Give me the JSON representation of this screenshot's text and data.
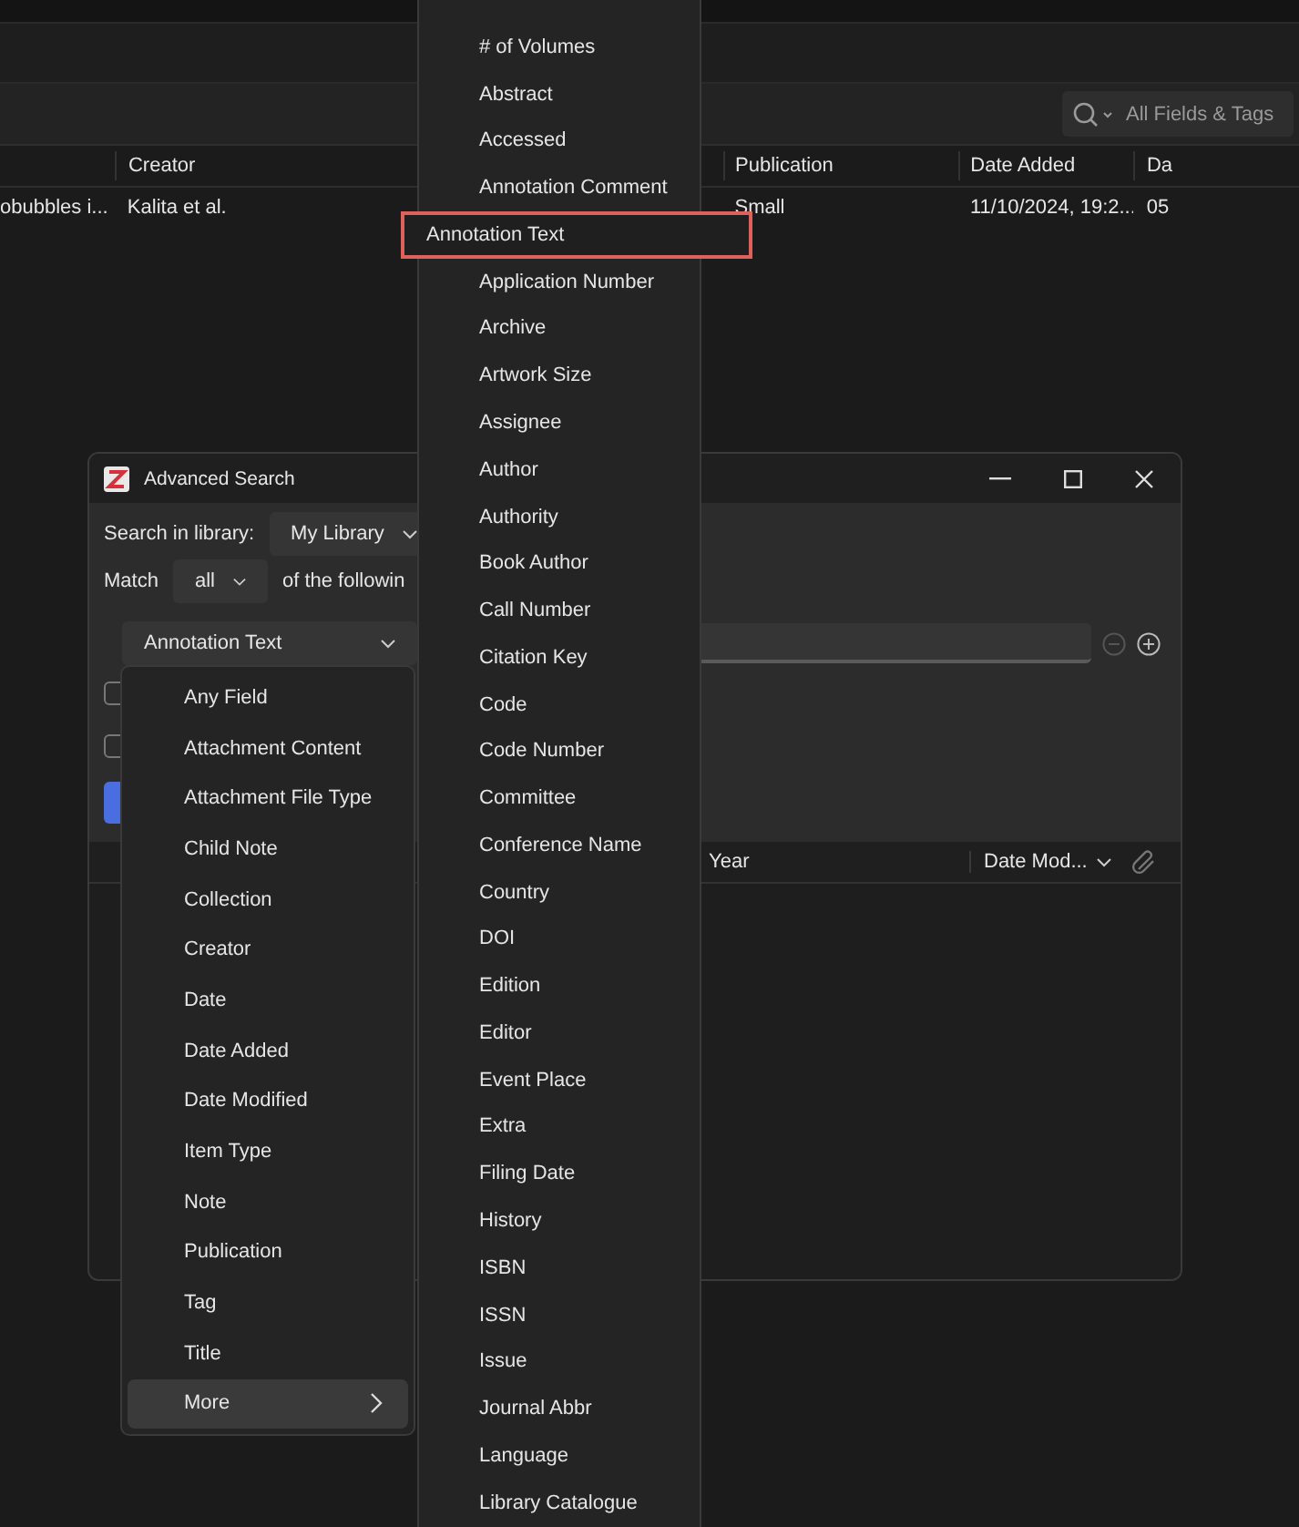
{
  "main_window": {
    "search": {
      "placeholder": "All Fields & Tags"
    },
    "table": {
      "columns": [
        {
          "label": "Creator"
        },
        {
          "label": "Publication"
        },
        {
          "label": "Date Added"
        },
        {
          "label": "Da"
        }
      ],
      "rows": [
        {
          "column_1": "obubbles i...",
          "cells": [
            "Kalita et al.",
            "Small",
            "11/10/2024, 19:2...",
            "05"
          ]
        }
      ]
    }
  },
  "dialog": {
    "title": "Advanced Search",
    "library_label": "Search in library:",
    "library": "My Library",
    "match_label": "Match",
    "match": "all",
    "match_suffix": "of the followin",
    "condition": {
      "field": "Annotation Text"
    },
    "checkboxes": [
      {
        "checked": false
      },
      {
        "checked": false
      }
    ],
    "results_columns": [
      {
        "label": "Year",
        "sorted": false
      },
      {
        "label": "Date Mod...",
        "sorted": true
      }
    ]
  },
  "field_menu": {
    "items": [
      {
        "label": "Any Field",
        "kind": "item",
        "selected": false
      },
      {
        "label": "Attachment Content",
        "kind": "item",
        "selected": false
      },
      {
        "label": "Attachment File Type",
        "kind": "item",
        "selected": false
      },
      {
        "label": "Child Note",
        "kind": "item",
        "selected": false
      },
      {
        "label": "Collection",
        "kind": "item",
        "selected": false
      },
      {
        "label": "Creator",
        "kind": "item",
        "selected": false
      },
      {
        "label": "Date",
        "kind": "item",
        "selected": false
      },
      {
        "label": "Date Added",
        "kind": "item",
        "selected": false
      },
      {
        "label": "Date Modified",
        "kind": "item",
        "selected": false
      },
      {
        "label": "Item Type",
        "kind": "item",
        "selected": false
      },
      {
        "label": "Note",
        "kind": "item",
        "selected": false
      },
      {
        "label": "Publication",
        "kind": "item",
        "selected": false
      },
      {
        "label": "Tag",
        "kind": "item",
        "selected": false
      },
      {
        "label": "Title",
        "kind": "item",
        "selected": false
      },
      {
        "label": "More",
        "kind": "submenu",
        "selected": true
      }
    ]
  },
  "more_menu": {
    "items": [
      {
        "label": "# of Volumes",
        "selected": false
      },
      {
        "label": "Abstract",
        "selected": false
      },
      {
        "label": "Accessed",
        "selected": false
      },
      {
        "label": "Annotation Comment",
        "selected": false
      },
      {
        "label": "Annotation Text",
        "selected": true
      },
      {
        "label": "Application Number",
        "selected": false
      },
      {
        "label": "Archive",
        "selected": false
      },
      {
        "label": "Artwork Size",
        "selected": false
      },
      {
        "label": "Assignee",
        "selected": false
      },
      {
        "label": "Author",
        "selected": false
      },
      {
        "label": "Authority",
        "selected": false
      },
      {
        "label": "Book Author",
        "selected": false
      },
      {
        "label": "Call Number",
        "selected": false
      },
      {
        "label": "Citation Key",
        "selected": false
      },
      {
        "label": "Code",
        "selected": false
      },
      {
        "label": "Code Number",
        "selected": false
      },
      {
        "label": "Committee",
        "selected": false
      },
      {
        "label": "Conference Name",
        "selected": false
      },
      {
        "label": "Country",
        "selected": false
      },
      {
        "label": "DOI",
        "selected": false
      },
      {
        "label": "Edition",
        "selected": false
      },
      {
        "label": "Editor",
        "selected": false
      },
      {
        "label": "Event Place",
        "selected": false
      },
      {
        "label": "Extra",
        "selected": false
      },
      {
        "label": "Filing Date",
        "selected": false
      },
      {
        "label": "History",
        "selected": false
      },
      {
        "label": "ISBN",
        "selected": false
      },
      {
        "label": "ISSN",
        "selected": false
      },
      {
        "label": "Issue",
        "selected": false
      },
      {
        "label": "Journal Abbr",
        "selected": false
      },
      {
        "label": "Language",
        "selected": false
      },
      {
        "label": "Library Catalogue",
        "selected": false
      }
    ]
  }
}
